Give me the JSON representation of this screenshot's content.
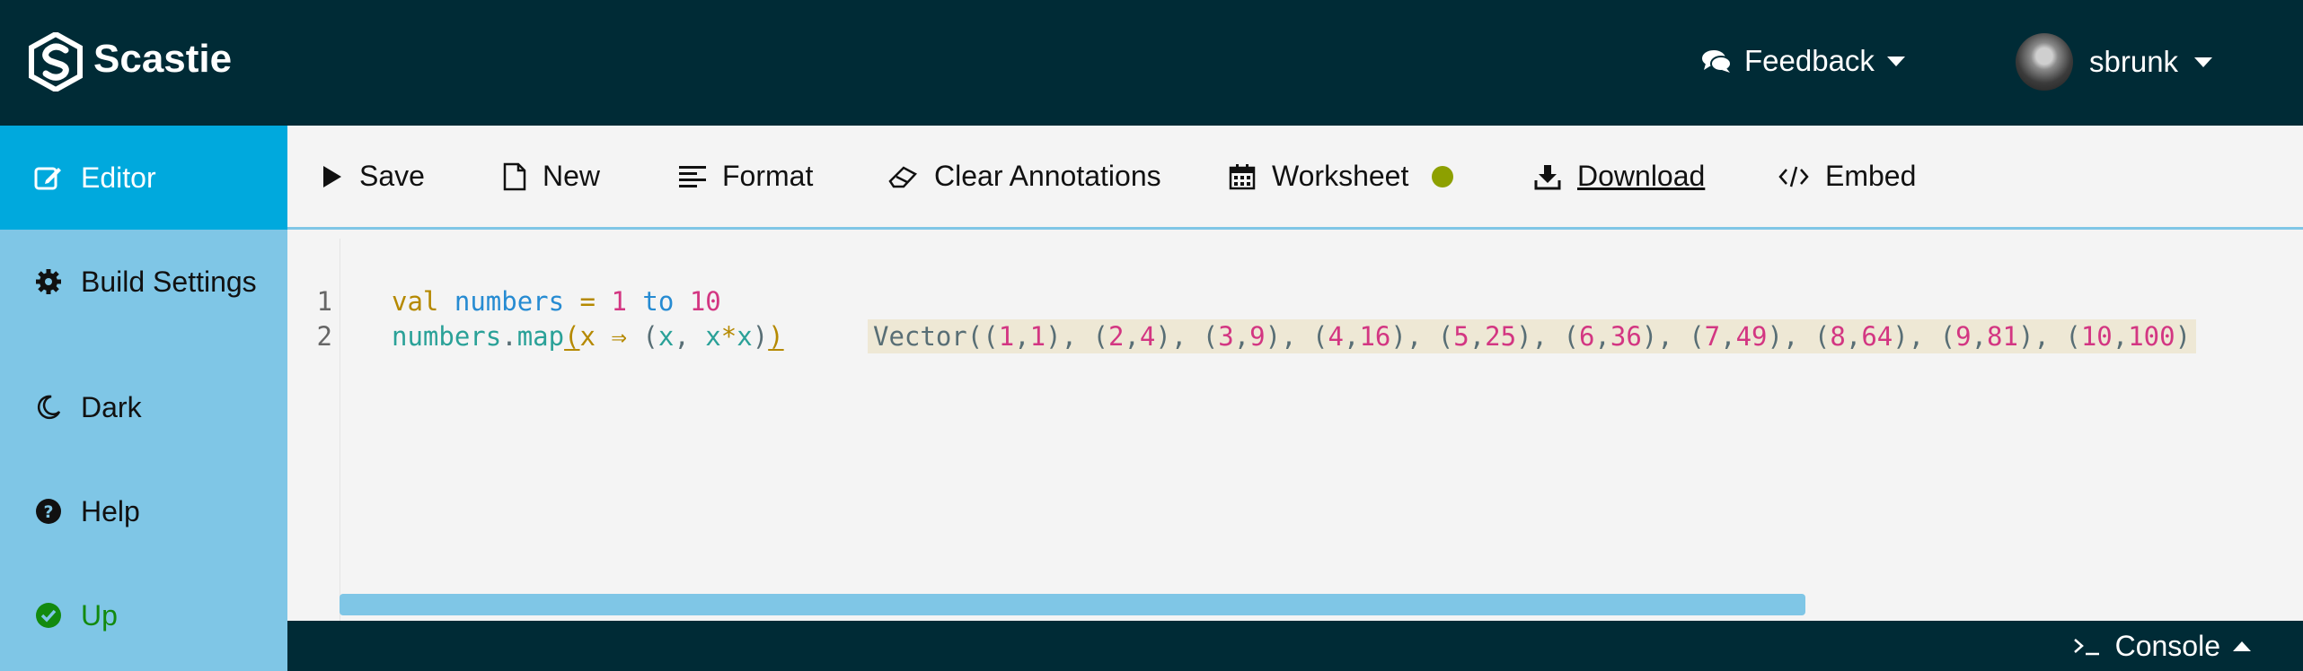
{
  "header": {
    "brand": "Scastie",
    "feedback_label": "Feedback",
    "username": "sbrunk"
  },
  "sidebar": {
    "items": [
      {
        "label": "Editor",
        "icon": "edit-icon"
      },
      {
        "label": "Build Settings",
        "icon": "gear-icon"
      },
      {
        "label": "Dark",
        "icon": "moon-icon"
      },
      {
        "label": "Help",
        "icon": "question-circle-icon"
      },
      {
        "label": "Up",
        "icon": "check-circle-icon"
      }
    ]
  },
  "toolbar": {
    "save_label": "Save",
    "new_label": "New",
    "format_label": "Format",
    "clear_label": "Clear Annotations",
    "worksheet_label": "Worksheet",
    "download_label": "Download",
    "embed_label": "Embed"
  },
  "editor": {
    "line_numbers": [
      "1",
      "2"
    ],
    "result_prefix": "Vector",
    "result_pairs": [
      [
        "1",
        "1"
      ],
      [
        "2",
        "4"
      ],
      [
        "3",
        "9"
      ],
      [
        "4",
        "16"
      ],
      [
        "5",
        "25"
      ],
      [
        "6",
        "36"
      ],
      [
        "7",
        "49"
      ],
      [
        "8",
        "64"
      ],
      [
        "9",
        "81"
      ],
      [
        "10",
        "100"
      ]
    ]
  },
  "console": {
    "label": "Console"
  },
  "colors": {
    "topbar": "#002b36",
    "sidebar": "#7fc6e6",
    "active_tab": "#00a9dd",
    "status_ok": "#138a0f",
    "worksheet_dot": "#8da000",
    "result_bg": "#eee8d5"
  }
}
